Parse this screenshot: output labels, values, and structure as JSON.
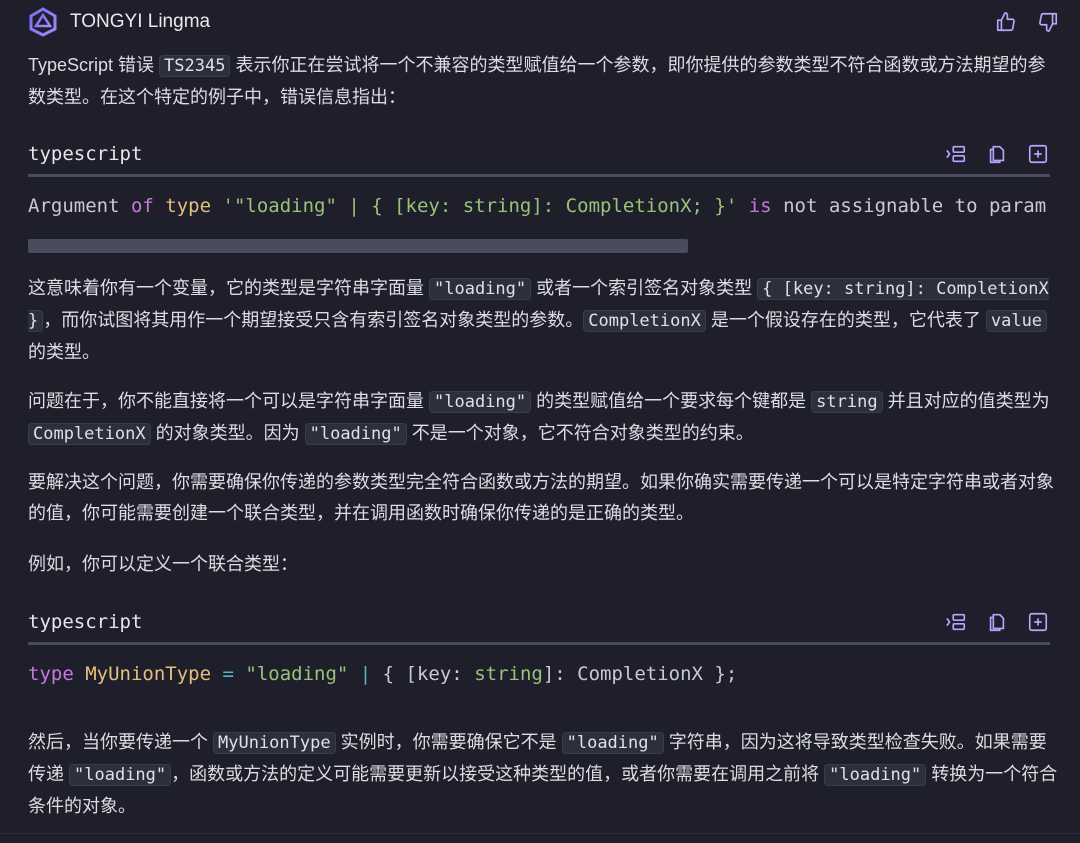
{
  "app": {
    "name": "TONGYI Lingma"
  },
  "colors": {
    "background": "#1e1f2b",
    "code_bg": "#2d2f3c",
    "keyword": "#c678dd",
    "string": "#98c379",
    "type": "#e5c07b"
  },
  "header": {
    "like_icon": "thumbs-up-icon",
    "dislike_icon": "thumbs-down-icon"
  },
  "p1": {
    "t1": "TypeScript 错误 ",
    "c1": "TS2345",
    "t2": " 表示你正在尝试将一个不兼容的类型赋值给一个参数，即你提供的参数类型不符合函数或方法期望的参数类型。在这个特定的例子中，错误信息指出："
  },
  "code1": {
    "lang": "typescript",
    "tokens": {
      "a": "Argument ",
      "b": "of",
      "c": " ",
      "d": "type",
      "e": " ",
      "f": "'\"loading\" | { [key: string]: CompletionX; }'",
      "g": " ",
      "h": "is",
      "i": " not assignable to param"
    }
  },
  "p2": {
    "t1": "这意味着你有一个变量，它的类型是字符串字面量 ",
    "c1": "\"loading\"",
    "t2": " 或者一个索引签名对象类型 ",
    "c2": "{ [key: string]: CompletionX }",
    "t3": "，而你试图将其用作一个期望接受只含有索引签名对象类型的参数。",
    "c3": "CompletionX",
    "t4": " 是一个假设存在的类型，它代表了 ",
    "c4": "value",
    "t5": " 的类型。"
  },
  "p3": {
    "t1": "问题在于，你不能直接将一个可以是字符串字面量 ",
    "c1": "\"loading\"",
    "t2": " 的类型赋值给一个要求每个键都是 ",
    "c2": "string",
    "t3": " 并且对应的值类型为 ",
    "c3": "CompletionX",
    "t4": " 的对象类型。因为 ",
    "c4": "\"loading\"",
    "t5": " 不是一个对象，它不符合对象类型的约束。"
  },
  "p4": {
    "text": "要解决这个问题，你需要确保你传递的参数类型完全符合函数或方法的期望。如果你确实需要传递一个可以是特定字符串或者对象的值，你可能需要创建一个联合类型，并在调用函数时确保你传递的是正确的类型。"
  },
  "p5": {
    "text": "例如，你可以定义一个联合类型："
  },
  "code2": {
    "lang": "typescript",
    "tokens": {
      "a": "type",
      "b": " ",
      "c": "MyUnionType",
      "d": " = ",
      "e": "\"loading\"",
      "f": " | ",
      "g": "{ [key: ",
      "h": "string",
      "i": "]: CompletionX };"
    }
  },
  "p6": {
    "t1": "然后，当你要传递一个 ",
    "c1": "MyUnionType",
    "t2": " 实例时，你需要确保它不是 ",
    "c2": "\"loading\"",
    "t3": " 字符串，因为这将导致类型检查失败。如果需要传递 ",
    "c3": "\"loading\"",
    "t4": "，函数或方法的定义可能需要更新以接受这种类型的值，或者你需要在调用之前将 ",
    "c4": "\"loading\"",
    "t5": " 转换为一个符合条件的对象。"
  },
  "codeblock_icons": [
    "insert-icon",
    "copy-icon",
    "new-file-icon"
  ]
}
